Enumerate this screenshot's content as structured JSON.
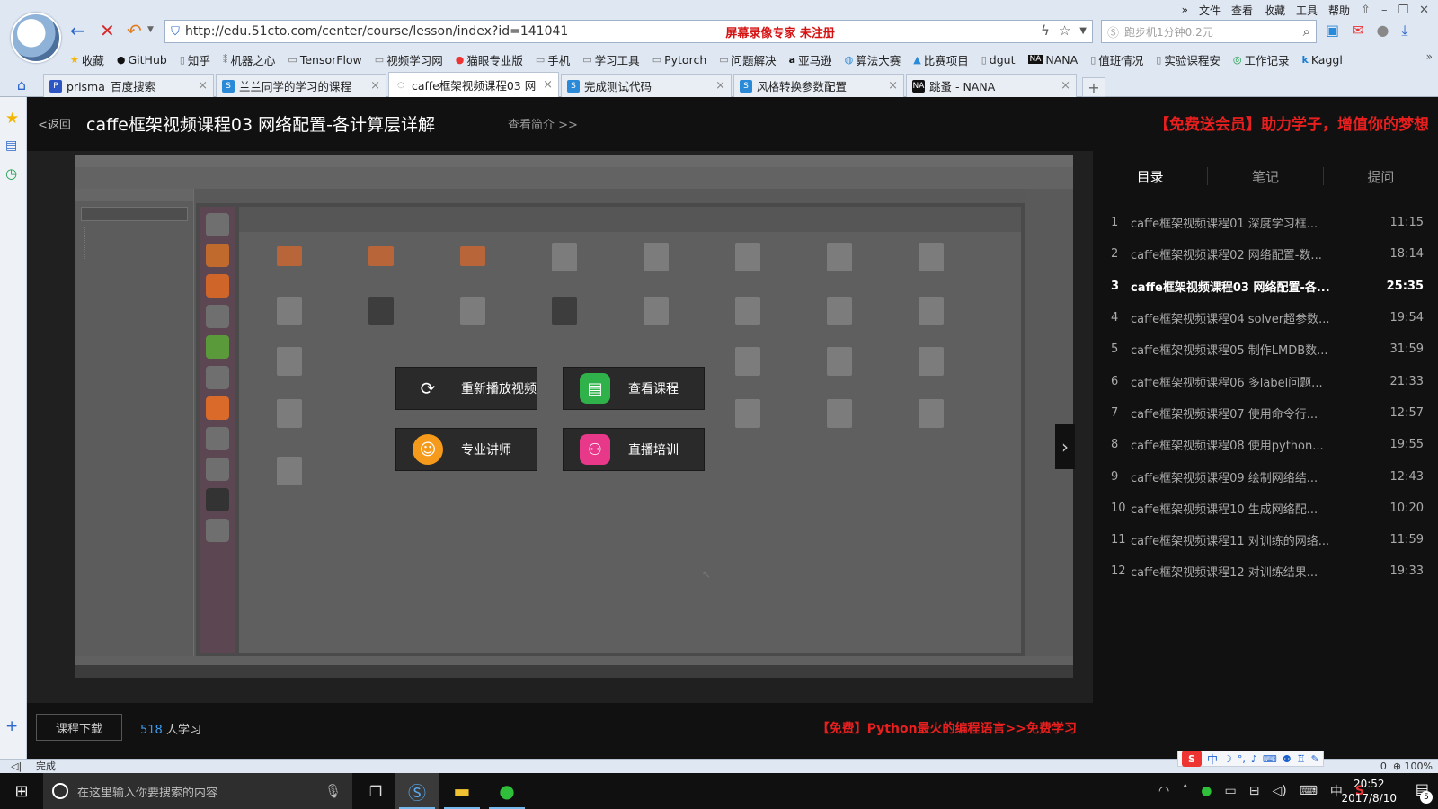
{
  "menubar": {
    "chevron": "»",
    "items": [
      "文件",
      "查看",
      "收藏",
      "工具",
      "帮助"
    ],
    "window_controls": [
      "⇧",
      "–",
      "❐",
      "✕"
    ]
  },
  "browser": {
    "url": "http://edu.51cto.com/center/course/lesson/index?id=141041",
    "recorder_watermark": "屏幕录像专家  未注册",
    "search_placeholder": "跑步机1分钟0.2元",
    "bookmarks": [
      {
        "icon": "★",
        "label": "收藏"
      },
      {
        "icon": "●",
        "label": "GitHub"
      },
      {
        "icon": "▯",
        "label": "知乎"
      },
      {
        "icon": "⁑",
        "label": "机器之心"
      },
      {
        "icon": "▭",
        "label": "TensorFlow"
      },
      {
        "icon": "▭",
        "label": "视频学习网"
      },
      {
        "icon": "●",
        "label": "猫眼专业版"
      },
      {
        "icon": "▭",
        "label": "手机"
      },
      {
        "icon": "▭",
        "label": "学习工具"
      },
      {
        "icon": "▭",
        "label": "Pytorch"
      },
      {
        "icon": "▭",
        "label": "问题解决"
      },
      {
        "icon": "a",
        "label": "亚马逊"
      },
      {
        "icon": "◍",
        "label": "算法大赛"
      },
      {
        "icon": "▲",
        "label": "比赛项目"
      },
      {
        "icon": "▯",
        "label": "dgut"
      },
      {
        "icon": "NA",
        "label": "NANA"
      },
      {
        "icon": "▯",
        "label": "值班情况"
      },
      {
        "icon": "▯",
        "label": "实验课程安"
      },
      {
        "icon": "◎",
        "label": "工作记录"
      },
      {
        "icon": "k",
        "label": "Kaggl"
      }
    ],
    "bookmarks_more": "»",
    "tabs": [
      {
        "fav": "P",
        "title": "prisma_百度搜索",
        "close": "×"
      },
      {
        "fav": "S",
        "title": "兰兰同学的学习的课程_",
        "close": "×"
      },
      {
        "fav": "◌",
        "title": "caffe框架视频课程03 网",
        "close": "×"
      },
      {
        "fav": "S",
        "title": "完成测试代码",
        "close": "×"
      },
      {
        "fav": "S",
        "title": "风格转换参数配置",
        "close": "×"
      },
      {
        "fav": "NA",
        "title": "跳蚤 - NANA",
        "close": "×"
      }
    ],
    "new_tab": "+"
  },
  "page": {
    "back": "<返回",
    "course_title": "caffe框架视频课程03 网络配置-各计算层详解",
    "intro_link": "查看简介 >>",
    "promo_top": "【免费送会员】助力学子，增值你的梦想",
    "overlay_buttons": [
      {
        "label": "重新播放视频",
        "icon": "⟳"
      },
      {
        "label": "查看课程",
        "icon": "▤"
      },
      {
        "label": "专业讲师",
        "icon": "☺"
      },
      {
        "label": "直播培训",
        "icon": "⚇"
      }
    ],
    "download": "课程下载",
    "learners_count": "518",
    "learners_suffix": " 人学习",
    "promo_bottom": "【免费】Python最火的编程语言>>免费学习",
    "next_arrow": "›"
  },
  "sidebar": {
    "tabs": [
      "目录",
      "笔记",
      "提问"
    ],
    "lessons": [
      {
        "num": "1",
        "title": "caffe框架视频课程01 深度学习框...",
        "duration": "11:15"
      },
      {
        "num": "2",
        "title": "caffe框架视频课程02 网络配置-数...",
        "duration": "18:14"
      },
      {
        "num": "3",
        "title": "caffe框架视频课程03 网络配置-各...",
        "duration": "25:35"
      },
      {
        "num": "4",
        "title": "caffe框架视频课程04 solver超参数...",
        "duration": "19:54"
      },
      {
        "num": "5",
        "title": "caffe框架视频课程05 制作LMDB数...",
        "duration": "31:59"
      },
      {
        "num": "6",
        "title": "caffe框架视频课程06 多label问题...",
        "duration": "21:33"
      },
      {
        "num": "7",
        "title": "caffe框架视频课程07 使用命令行...",
        "duration": "12:57"
      },
      {
        "num": "8",
        "title": "caffe框架视频课程08 使用python...",
        "duration": "19:55"
      },
      {
        "num": "9",
        "title": "caffe框架视频课程09 绘制网络结...",
        "duration": "12:43"
      },
      {
        "num": "10",
        "title": "caffe框架视频课程10 生成网络配...",
        "duration": "10:20"
      },
      {
        "num": "11",
        "title": "caffe框架视频课程11 对训练的网络...",
        "duration": "11:59"
      },
      {
        "num": "12",
        "title": "caffe框架视频课程12 对训练结果...",
        "duration": "19:33"
      }
    ],
    "current_index": 2
  },
  "statusbar": {
    "left_icon": "◁|",
    "text": "完成",
    "ime_label": "中",
    "zoom": "100%",
    "counter": "0"
  },
  "taskbar": {
    "search_placeholder": "在这里输入你要搜索的内容",
    "ime": "中",
    "time": "20:52",
    "date": "2017/8/10",
    "notifications": "5"
  },
  "colors": {
    "accent_red": "#e91f1f",
    "link_blue": "#3b9ef5",
    "page_bg": "#1b1b1b"
  }
}
